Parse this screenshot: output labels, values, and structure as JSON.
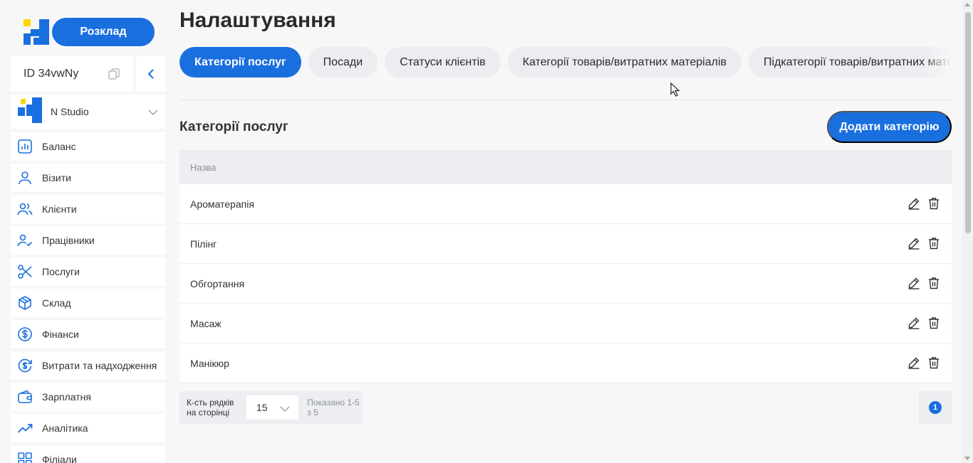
{
  "sidebar": {
    "schedule_button": "Розклад",
    "account_id": "ID 34vwNy",
    "studio_name": "N Studio",
    "items": [
      {
        "label": "Баланс",
        "icon": "chart-bars-icon"
      },
      {
        "label": "Візити",
        "icon": "user-icon"
      },
      {
        "label": "Клієнти",
        "icon": "users-icon"
      },
      {
        "label": "Працівники",
        "icon": "user-check-icon"
      },
      {
        "label": "Послуги",
        "icon": "scissors-icon"
      },
      {
        "label": "Склад",
        "icon": "box-icon"
      },
      {
        "label": "Фінанси",
        "icon": "dollar-circle-icon"
      },
      {
        "label": "Витрати та надходження",
        "icon": "dollar-refresh-icon"
      },
      {
        "label": "Зарплатня",
        "icon": "wallet-icon"
      },
      {
        "label": "Аналітика",
        "icon": "trend-up-icon"
      },
      {
        "label": "Філіали",
        "icon": "grid-icon"
      }
    ]
  },
  "header": {
    "title": "Налаштування"
  },
  "tabs": [
    {
      "label": "Категорії послуг",
      "active": true
    },
    {
      "label": "Посади",
      "active": false
    },
    {
      "label": "Статуси клієнтів",
      "active": false
    },
    {
      "label": "Категорії товарів/витратних матеріалів",
      "active": false
    },
    {
      "label": "Підкатегорії товарів/витратних матеріалів",
      "active": false
    }
  ],
  "section": {
    "title": "Категорії послуг",
    "add_button": "Додати категорію"
  },
  "table": {
    "column_header": "Назва",
    "rows": [
      "Ароматерапія",
      "Пілінг",
      "Обгортання",
      "Масаж",
      "Манікюр"
    ]
  },
  "pagination": {
    "rows_per_page_label": "К-сть рядків на сторінці",
    "rows_per_page_value": "15",
    "shown_text": "Показано 1-5 з 5",
    "current_page": "1"
  },
  "colors": {
    "accent": "#1a6fdf",
    "logo_yellow": "#ffd600"
  }
}
